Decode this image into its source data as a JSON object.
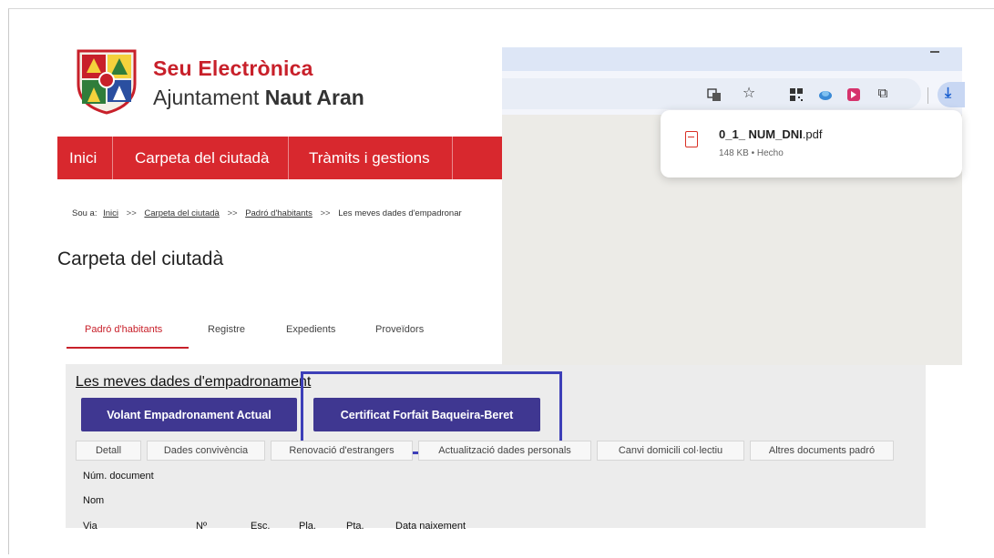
{
  "site": {
    "brand_title": "Seu Electrònica",
    "brand_sub_prefix": "Ajuntament",
    "brand_sub_bold": "Naut Aran",
    "nav": [
      "Inici",
      "Carpeta del ciutadà",
      "Tràmits i gestions"
    ],
    "breadcrumb": {
      "prefix": "Sou a:",
      "items": [
        "Inici",
        "Carpeta del ciutadà",
        "Padró d'habitants"
      ],
      "current": "Les meves dades d'empadronar",
      "separator": ">>"
    },
    "page_title": "Carpeta del ciutadà",
    "tabs": [
      "Padró d'habitants",
      "Registre",
      "Expedients",
      "Proveïdors"
    ],
    "section_heading": "Les meves dades d'empadronament",
    "buttons": {
      "volant": "Volant Empadronament Actual",
      "certificat": "Certificat Forfait Baqueira-Beret"
    },
    "subtabs": [
      "Detall",
      "Dades convivència",
      "Renovació d'estrangers",
      "Actualització dades personals",
      "Canvi domicili col·lectiu",
      "Altres documents padró"
    ],
    "fields": {
      "num_document": "Núm. document",
      "nom": "Nom",
      "via": "Via",
      "numero": "Nº",
      "esc": "Esc.",
      "pla": "Pla.",
      "pta": "Pta.",
      "data_naixement": "Data naixement"
    }
  },
  "browser": {
    "download": {
      "file_bold": "0_1_ NUM_DNI",
      "file_ext": ".pdf",
      "meta": "148 KB • Hecho"
    },
    "toolbar_icons": [
      "translate-icon",
      "star-icon",
      "qr-code-icon",
      "extension-cloud-icon",
      "extension-red-icon",
      "puzzle-icon",
      "download-icon"
    ]
  },
  "colors": {
    "brand_red": "#d8282e",
    "button_purple": "#3f3791",
    "highlight_blue": "#3d3fb8"
  }
}
